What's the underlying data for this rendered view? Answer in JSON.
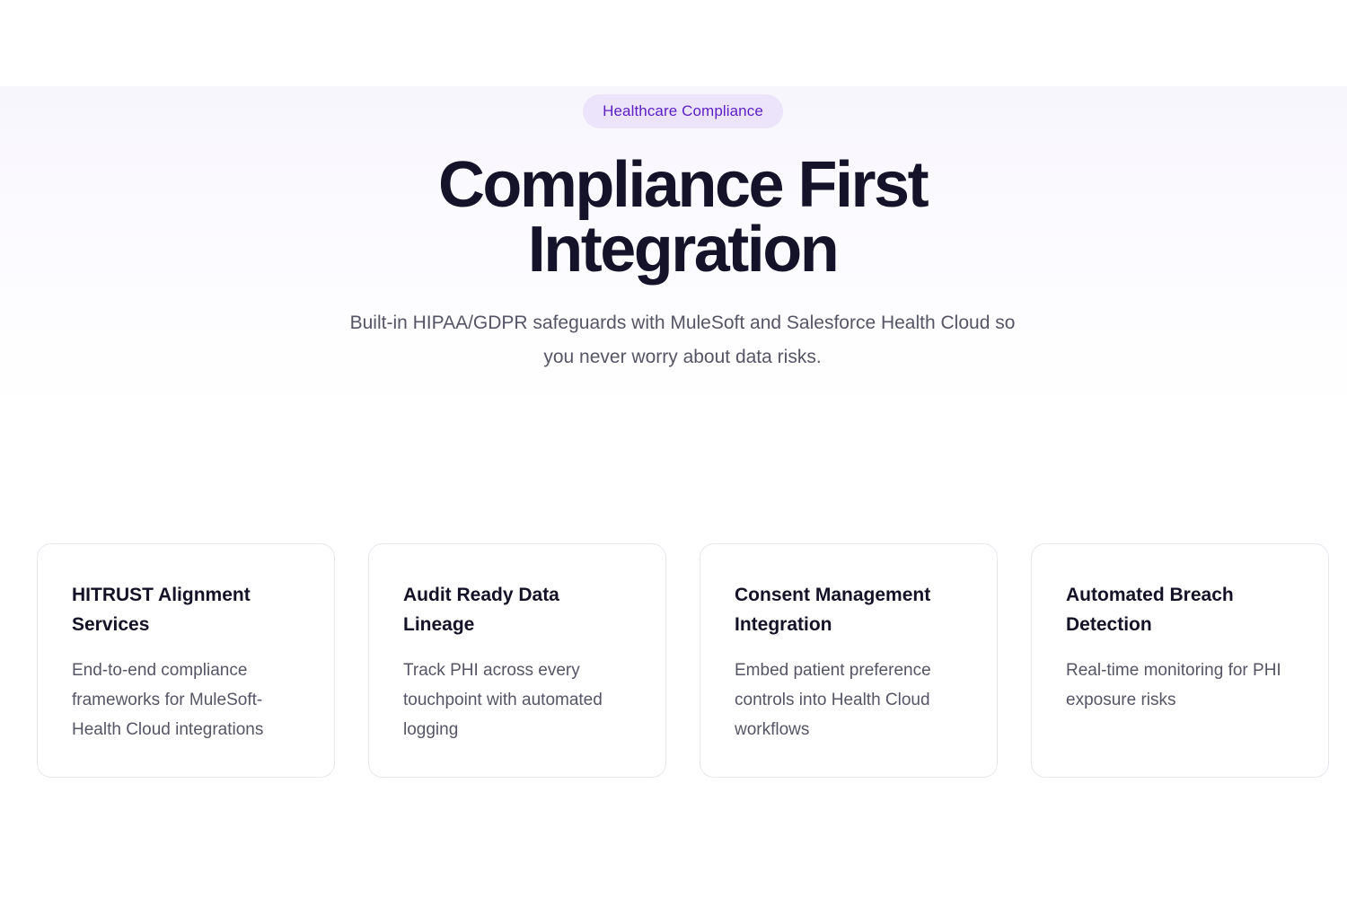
{
  "hero": {
    "badge": "Healthcare Compliance",
    "title_line1": "Compliance First",
    "title_line2": "Integration",
    "subtitle_line1": "Built-in HIPAA/GDPR safeguards with MuleSoft and Salesforce Health Cloud so",
    "subtitle_line2": "you never worry about data risks."
  },
  "features": [
    {
      "title": "HITRUST Alignment Services",
      "description": "End-to-end compliance frameworks for MuleSoft-Health Cloud integrations"
    },
    {
      "title": "Audit Ready Data Lineage",
      "description": "Track PHI across every touchpoint with automated logging"
    },
    {
      "title": "Consent Management Integration",
      "description": "Embed patient preference controls into Health Cloud workflows"
    },
    {
      "title": "Automated Breach Detection",
      "description": "Real-time monitoring for PHI exposure risks"
    }
  ],
  "colors": {
    "badge_bg": "#ece4fb",
    "badge_text": "#5b1fc4",
    "heading": "#151329",
    "body_text": "#555566",
    "card_border": "#e7e7ee"
  }
}
